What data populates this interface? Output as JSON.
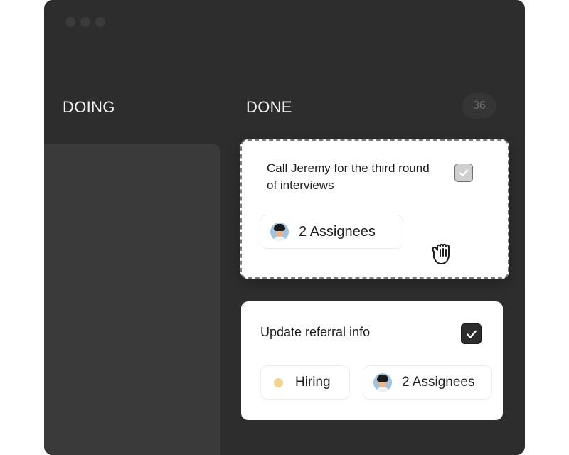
{
  "board": {
    "columns": {
      "doing": {
        "title": "DOING"
      },
      "done": {
        "title": "DONE",
        "count": "36"
      }
    },
    "cards": [
      {
        "title": "Call Jeremy for the third round of interviews",
        "assignees_label": "2 Assignees",
        "checked": true,
        "state": "dragging"
      },
      {
        "title": "Update referral info",
        "tag_label": "Hiring",
        "assignees_label": "2 Assignees",
        "checked": true
      }
    ]
  },
  "colors": {
    "window_bg": "#2d2d2d",
    "column_panel": "#3a3a3a",
    "card_bg": "#ffffff",
    "hiring_tag": "#f3d38a",
    "checkbox_checked": "#2d2d2d"
  },
  "icons": {
    "window_controls": "three-dots",
    "checkbox": "check-icon",
    "cursor": "grab-hand-icon",
    "avatar": "person-avatar"
  }
}
